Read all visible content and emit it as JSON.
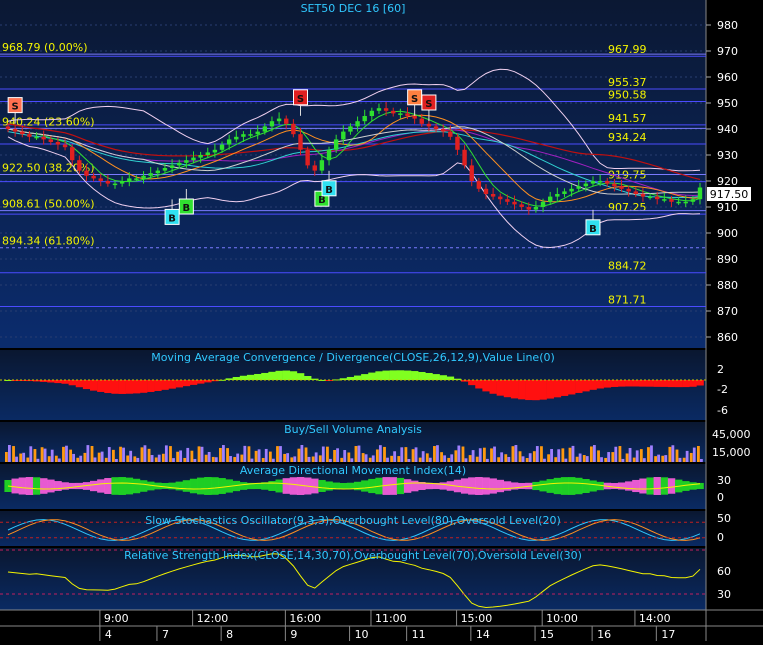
{
  "window": {
    "title": "SET50 DEC 16   [60]",
    "last_price_label": "917.50"
  },
  "colors": {
    "background": "#000000",
    "main_panel_top": "#0c1a33",
    "main_panel_bottom": "#0a2a66",
    "grid": "#d0d0ff",
    "text_yellow": "#f4f400",
    "text_cyan": "#30c8ff",
    "axis_text": "#ffffff",
    "up_candle": "#2ee02e",
    "down_candle": "#e02020",
    "fib_line": "#5a5aff"
  },
  "price_panel": {
    "y_ticks": [
      980,
      970,
      960,
      950,
      940,
      930,
      920,
      910,
      900,
      890,
      880,
      870,
      860
    ],
    "level_lines": [
      {
        "value": 967.99,
        "label": "967.99",
        "side": "right"
      },
      {
        "value": 955.37,
        "label": "955.37",
        "side": "right"
      },
      {
        "value": 950.58,
        "label": "950.58",
        "side": "right"
      },
      {
        "value": 941.57,
        "label": "941.57",
        "side": "right"
      },
      {
        "value": 934.24,
        "label": "934.24",
        "side": "right"
      },
      {
        "value": 919.75,
        "label": "919.75",
        "side": "right"
      },
      {
        "value": 907.25,
        "label": "907.25",
        "side": "right"
      },
      {
        "value": 884.72,
        "label": "884.72",
        "side": "right"
      },
      {
        "value": 871.71,
        "label": "871.71",
        "side": "right"
      }
    ],
    "fib_levels": [
      {
        "value": 968.79,
        "label": "968.79 (0.00%)"
      },
      {
        "value": 940.24,
        "label": "940.24 (23.60%)"
      },
      {
        "value": 922.5,
        "label": "922.50 (38.20%)"
      },
      {
        "value": 908.61,
        "label": "908.61 (50.00%)"
      },
      {
        "value": 894.34,
        "label": "894.34 (61.80%)"
      }
    ],
    "signals": [
      {
        "type": "S",
        "bar": 1,
        "value": 949
      },
      {
        "type": "B",
        "bar": 23,
        "value": 906
      },
      {
        "type": "B",
        "bar": 25,
        "value": 910
      },
      {
        "type": "S",
        "bar": 41,
        "value": 952
      },
      {
        "type": "B",
        "bar": 44,
        "value": 913
      },
      {
        "type": "B",
        "bar": 45,
        "value": 917
      },
      {
        "type": "S",
        "bar": 57,
        "value": 952
      },
      {
        "type": "S",
        "bar": 59,
        "value": 950
      },
      {
        "type": "B",
        "bar": 82,
        "value": 902
      }
    ]
  },
  "time_axis": {
    "time_labels": [
      {
        "bar": 14,
        "label": "9:00"
      },
      {
        "bar": 27,
        "label": "12:00"
      },
      {
        "bar": 40,
        "label": "16:00"
      },
      {
        "bar": 52,
        "label": "11:00"
      },
      {
        "bar": 64,
        "label": "15:00"
      },
      {
        "bar": 76,
        "label": "10:00"
      },
      {
        "bar": 89,
        "label": "14:00"
      }
    ],
    "day_labels": [
      {
        "bar": 14,
        "label": "4"
      },
      {
        "bar": 22,
        "label": "7"
      },
      {
        "bar": 31,
        "label": "8"
      },
      {
        "bar": 40,
        "label": "9"
      },
      {
        "bar": 49,
        "label": "10"
      },
      {
        "bar": 57,
        "label": "11"
      },
      {
        "bar": 66,
        "label": "14"
      },
      {
        "bar": 75,
        "label": "15"
      },
      {
        "bar": 83,
        "label": "16"
      },
      {
        "bar": 92,
        "label": "17"
      }
    ]
  },
  "indicators": {
    "macd": {
      "title": "Moving Average Convergence / Divergence(CLOSE,26,12,9),Value Line(0)",
      "ticks": [
        "2",
        "-2",
        "-6"
      ]
    },
    "volume": {
      "title": "Buy/Sell Volume Analysis",
      "ticks": [
        "45,000",
        "15,000"
      ]
    },
    "adx": {
      "title": "Average Directional Movement Index(14)",
      "ticks": [
        "30",
        "0"
      ]
    },
    "stoch": {
      "title": "Slow Stochastics Oscillator(9,3,3),Overbought Level(80),Oversold Level(20)",
      "ticks": [
        "50",
        "0"
      ]
    },
    "rsi": {
      "title": "Relative Strength Index(CLOSE,14,30,70),Overbought Level(70),Oversold Level(30)",
      "ticks": [
        "60",
        "30"
      ]
    }
  },
  "chart_data": {
    "type": "line",
    "title": "SET50 DEC 16   [60]",
    "xlabel": "",
    "ylabel": "",
    "ylim": [
      855,
      985
    ],
    "x": [
      0,
      1,
      2,
      3,
      4,
      5,
      6,
      7,
      8,
      9,
      10,
      11,
      12,
      13,
      14,
      15,
      16,
      17,
      18,
      19,
      20,
      21,
      22,
      23,
      24,
      25,
      26,
      27,
      28,
      29,
      30,
      31,
      32,
      33,
      34,
      35,
      36,
      37,
      38,
      39,
      40,
      41,
      42,
      43,
      44,
      45,
      46,
      47,
      48,
      49,
      50,
      51,
      52,
      53,
      54,
      55,
      56,
      57,
      58,
      59,
      60,
      61,
      62,
      63,
      64,
      65,
      66,
      67,
      68,
      69,
      70,
      71,
      72,
      73,
      74,
      75,
      76,
      77,
      78,
      79,
      80,
      81,
      82,
      83,
      84,
      85,
      86,
      87,
      88,
      89,
      90,
      91,
      92,
      93,
      94,
      95,
      96,
      97
    ],
    "series": [
      {
        "values": [
          940,
          939,
          938,
          937,
          937,
          936,
          935,
          934,
          933,
          928,
          924,
          922,
          921,
          920,
          919,
          919,
          920,
          921,
          921,
          922,
          923,
          924,
          925,
          926,
          927,
          928,
          929,
          930,
          931,
          932,
          934,
          936,
          937,
          938,
          938,
          939,
          941,
          943,
          944,
          942,
          938,
          932,
          926,
          924,
          928,
          932,
          936,
          939,
          941,
          943,
          945,
          947,
          948,
          947,
          946,
          946,
          945,
          944,
          942,
          941,
          940,
          939,
          937,
          932,
          926,
          920,
          917,
          915,
          914,
          913,
          912,
          911,
          910,
          909,
          910,
          912,
          914,
          915,
          916,
          917,
          918,
          919,
          920,
          920,
          919,
          918,
          917,
          916,
          915,
          914,
          914,
          913,
          913,
          912,
          912,
          912,
          913,
          917.5
        ]
      }
    ]
  }
}
